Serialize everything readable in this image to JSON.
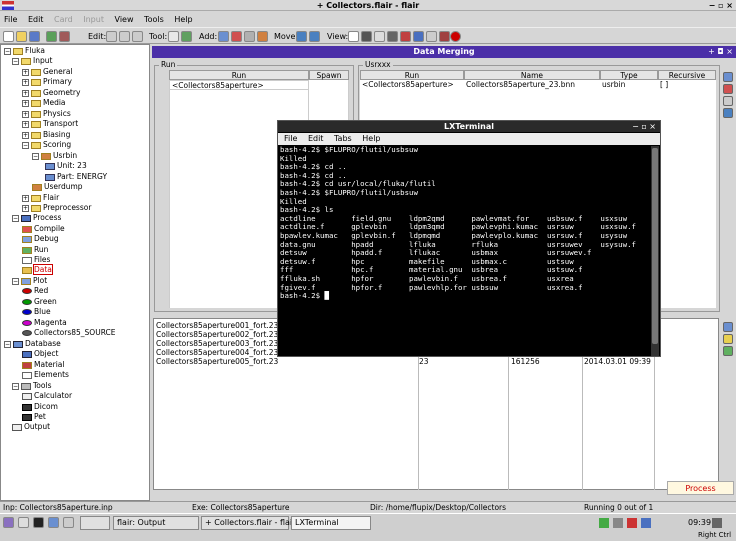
{
  "window": {
    "title": "+ Collectors.flair - flair",
    "controls": "− ▫ ×"
  },
  "menubar": {
    "file": "File",
    "edit": "Edit",
    "card": "Card",
    "input": "Input",
    "view": "View",
    "tools": "Tools",
    "help": "Help"
  },
  "toolbar": {
    "edit_label": "Edit:",
    "tool_label": "Tool:",
    "add_label": "Add:",
    "move_label": "Move:",
    "view_label": "View:"
  },
  "tree": {
    "fluka": "Fluka",
    "input": "Input",
    "general": "General",
    "primary": "Primary",
    "geometry": "Geometry",
    "media": "Media",
    "physics": "Physics",
    "transport": "Transport",
    "biasing": "Biasing",
    "scoring": "Scoring",
    "usrbin": "Usrbin",
    "unit": "Unit: 23",
    "part": "Part: ENERGY",
    "userdump": "Userdump",
    "flair": "Flair",
    "preprocessor": "Preprocessor",
    "process": "Process",
    "compile": "Compile",
    "debug": "Debug",
    "run": "Run",
    "files": "Files",
    "data": "Data",
    "plot": "Plot",
    "red": "Red",
    "green": "Green",
    "blue": "Blue",
    "magenta": "Magenta",
    "collectors_source": "Collectors85_SOURCE",
    "database": "Database",
    "object": "Object",
    "material": "Material",
    "elements": "Elements",
    "tools": "Tools",
    "calculator": "Calculator",
    "dicom": "Dicom",
    "pet": "Pet",
    "output": "Output"
  },
  "data_merging": {
    "title": "Data Merging",
    "controls": "+ ◘ ×"
  },
  "run_group": {
    "label": "Run",
    "col_run": "Run",
    "col_spawn": "Spawn",
    "rows": [
      {
        "run": "<Collectors85aperture>",
        "spawn": ""
      }
    ]
  },
  "usrxxx_group": {
    "label": "Usrxxx",
    "col_run": "Run",
    "col_name": "Name",
    "col_type": "Type",
    "col_recursive": "Recursive",
    "rows": [
      {
        "run": "<Collectors85aperture>",
        "name": "Collectors85aperture_23.bnn",
        "type": "usrbin",
        "recursive": "[ ]"
      }
    ]
  },
  "files": [
    "Collectors85aperture001_fort.23",
    "Collectors85aperture002_fort.23",
    "Collectors85aperture003_fort.23",
    "Collectors85aperture004_fort.23",
    "Collectors85aperture005_fort.23"
  ],
  "files_partial": {
    "unit": "23",
    "size": "161256",
    "date": "2014.03.01 09:39"
  },
  "process_button": "Process",
  "statusbar": {
    "inp": "Inp: Collectors85aperture.inp",
    "exe": "Exe: Collectors85aperture",
    "dir": "Dir: /home/flupix/Desktop/Collectors",
    "running": "Running 0 out of 1"
  },
  "taskbar": {
    "flair_output": "flair: Output",
    "collectors_flair": "+ Collectors.flair - flair",
    "lxterminal": "LXTerminal",
    "clock": "09:39",
    "right_ctrl": "Right Ctrl"
  },
  "terminal": {
    "title": "LXTerminal",
    "menu": {
      "file": "File",
      "edit": "Edit",
      "tabs": "Tabs",
      "help": "Help"
    },
    "lines": [
      "bash-4.2$ $FLUPRO/flutil/usbsuw",
      "Killed",
      "bash-4.2$ cd ..",
      "bash-4.2$ cd ..",
      "bash-4.2$ cd usr/local/fluka/flutil",
      "bash-4.2$ $FLUPRO/flutil/usbsuw",
      "Killed",
      "bash-4.2$ ls",
      "actdline        field.gnu    ldpm2qmd      pawlevmat.for    usbsuw.f    usxsuw",
      "actdline.f      gplevbin     ldpm3qmd      pawlevphi.kumac  usrsuw      usxsuw.f",
      "bpawlev.kumac   gplevbin.f   ldpmqmd       pawlevplo.kumac  usrsuw.f    usysuw",
      "data.gnu        hpadd        lfluka        rfluka           usrsuwev    usysuw.f",
      "detsuw          hpadd.f      lflukac       usbmax           usrsuwev.f",
      "detsuw.f        hpc          makefile      usbmax.c         ustsuw",
      "fff             hpc.f        material.gnu  usbrea           ustsuw.f",
      "ffluka.sh       hpfor        pawlevbin.f   usbrea.f         usxrea",
      "fgivev.f        hpfor.f      pawlevhlp.for usbsuw           usxrea.f",
      "bash-4.2$ █"
    ]
  }
}
